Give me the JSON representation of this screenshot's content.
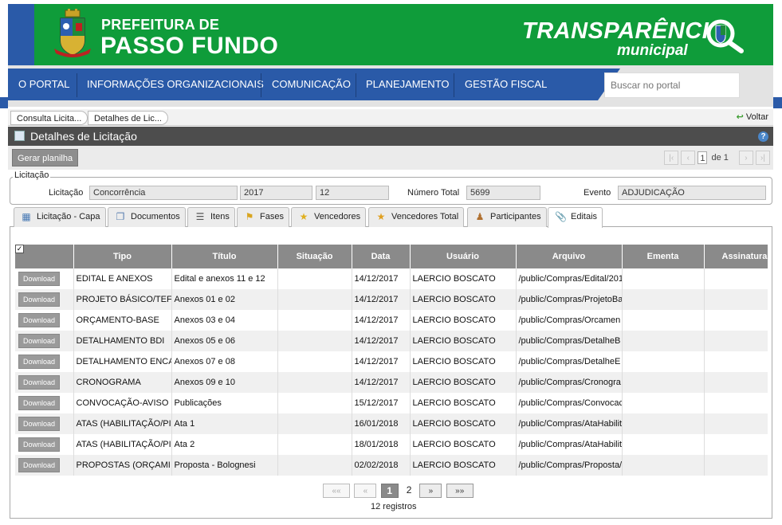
{
  "header": {
    "pref_line1": "PREFEITURA DE",
    "pref_line2": "PASSO FUNDO",
    "brand_line1": "TRANSPARÊNCI",
    "brand_line2": "municipal",
    "green": "#0f9c3a",
    "blue": "#2a5aa8"
  },
  "nav": {
    "items": [
      "O PORTAL",
      "INFORMAÇÕES ORGANIZACIONAIS",
      "COMUNICAÇÃO",
      "PLANEJAMENTO",
      "GESTÃO FISCAL"
    ],
    "search_placeholder": "Buscar no portal"
  },
  "breadcrumb": {
    "items": [
      "Consulta Licita...",
      "Detalhes de Lic..."
    ],
    "back": "Voltar"
  },
  "panel": {
    "title": "Detalhes de Licitação",
    "generate_button": "Gerar planilha",
    "page_value": "1",
    "page_of": "de 1"
  },
  "licitacao": {
    "legend": "Licitação",
    "label_licitacao": "Licitação",
    "modalidade": "Concorrência",
    "ano": "2017",
    "numero": "12",
    "label_numero_total": "Número Total",
    "numero_total": "5699",
    "label_evento": "Evento",
    "evento": "ADJUDICAÇÃO"
  },
  "tabs": [
    "Licitação - Capa",
    "Documentos",
    "Itens",
    "Fases",
    "Vencedores",
    "Vencedores Total",
    "Participantes",
    "Editais"
  ],
  "table": {
    "columns": [
      "Tipo",
      "Título",
      "Situação",
      "Data",
      "Usuário",
      "Arquivo",
      "Ementa",
      "Assinaturas Pendentes"
    ],
    "download_label": "Download",
    "rows": [
      [
        "EDITAL E ANEXOS",
        "Edital e anexos 11 e 12",
        "",
        "14/12/2017",
        "LAERCIO BOSCATO",
        "/public/Compras/Edital/201"
      ],
      [
        "PROJETO BÁSICO/TEF",
        "Anexos 01 e 02",
        "",
        "14/12/2017",
        "LAERCIO BOSCATO",
        "/public/Compras/ProjetoBa"
      ],
      [
        "ORÇAMENTO-BASE",
        "Anexos 03 e 04",
        "",
        "14/12/2017",
        "LAERCIO BOSCATO",
        "/public/Compras/Orcamen"
      ],
      [
        "DETALHAMENTO BDI",
        "Anexos 05 e 06",
        "",
        "14/12/2017",
        "LAERCIO BOSCATO",
        "/public/Compras/DetalheB"
      ],
      [
        "DETALHAMENTO ENCA",
        "Anexos 07 e 08",
        "",
        "14/12/2017",
        "LAERCIO BOSCATO",
        "/public/Compras/DetalheE"
      ],
      [
        "CRONOGRAMA",
        "Anexos 09 e 10",
        "",
        "14/12/2017",
        "LAERCIO BOSCATO",
        "/public/Compras/Cronogra"
      ],
      [
        "CONVOCAÇÃO-AVISO",
        "Publicações",
        "",
        "15/12/2017",
        "LAERCIO BOSCATO",
        "/public/Compras/Convocac"
      ],
      [
        "ATAS (HABILITAÇÃO/PI",
        "Ata 1",
        "",
        "16/01/2018",
        "LAERCIO BOSCATO",
        "/public/Compras/AtaHabilit"
      ],
      [
        "ATAS (HABILITAÇÃO/PI",
        "Ata 2",
        "",
        "18/01/2018",
        "LAERCIO BOSCATO",
        "/public/Compras/AtaHabilit"
      ],
      [
        "PROPOSTAS (ORÇAMI",
        "Proposta - Bolognesi",
        "",
        "02/02/2018",
        "LAERCIO BOSCATO",
        "/public/Compras/Proposta/"
      ]
    ]
  },
  "pager": {
    "first": "««",
    "prev": "«",
    "current": "1",
    "next_page": "2",
    "next": "»",
    "last": "»»",
    "records": "12 registros"
  }
}
